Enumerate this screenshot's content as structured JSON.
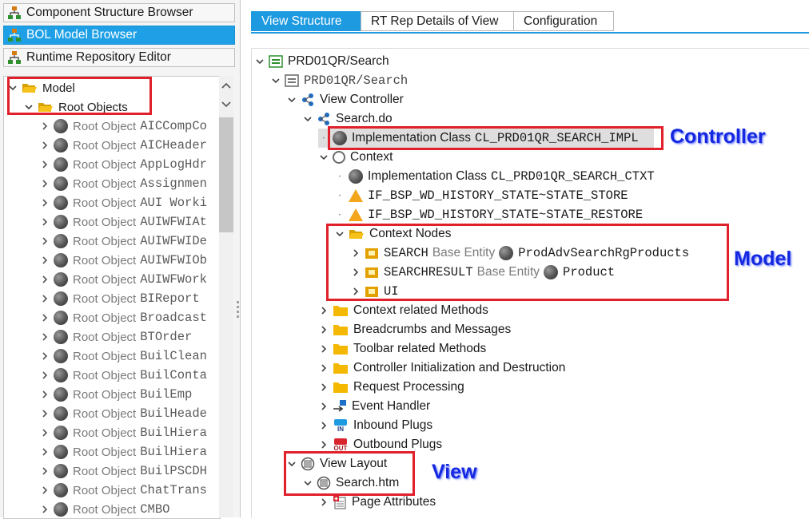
{
  "left_panel": {
    "nav": [
      {
        "label": "Component Structure Browser",
        "icon": "hierarchy-icon",
        "active": false
      },
      {
        "label": "BOL Model Browser",
        "icon": "hierarchy-icon",
        "active": true
      },
      {
        "label": "Runtime Repository Editor",
        "icon": "hierarchy-icon",
        "active": false
      }
    ],
    "tree": {
      "model_label": "Model",
      "root_objects_label": "Root Objects",
      "item_prefix": "Root Object",
      "items": [
        "AICCompCo",
        "AICHeader",
        "AppLogHdr",
        "Assignmen",
        "AUI Worki",
        "AUIWFWIAt",
        "AUIWFWIDe",
        "AUIWFWIOb",
        "AUIWFWork",
        "BIReport",
        "Broadcast",
        "BTOrder",
        "BuilClean",
        "BuilConta",
        "BuilEmp",
        "BuilHeade",
        "BuilHiera",
        "BuilHiera",
        "BuilPSCDH",
        "ChatTrans",
        "CMBO"
      ]
    }
  },
  "tabs": [
    "View Structure",
    "RT Rep Details of View",
    "Configuration"
  ],
  "tree": {
    "root": "PRD01QR/Search",
    "view": "PRD01QR/Search",
    "view_controller": "View Controller",
    "search_do": "Search.do",
    "impl_class_label": "Implementation Class",
    "impl_class_value": "CL_PRD01QR_SEARCH_IMPL",
    "context": "Context",
    "ctxt_class_label": "Implementation Class",
    "ctxt_class_value": "CL_PRD01QR_SEARCH_CTXT",
    "history_store": "IF_BSP_WD_HISTORY_STATE~STATE_STORE",
    "history_restore": "IF_BSP_WD_HISTORY_STATE~STATE_RESTORE",
    "context_nodes": "Context Nodes",
    "node1_name": "SEARCH",
    "node1_base": "Base Entity",
    "node1_entity": "ProdAdvSearchRgProducts",
    "node2_name": "SEARCHRESULT",
    "node2_base": "Base Entity",
    "node2_entity": "Product",
    "node3_name": "UI",
    "folders": [
      "Context related Methods",
      "Breadcrumbs and Messages",
      "Toolbar related Methods",
      "Controller Initialization and Destruction",
      "Request Processing"
    ],
    "event_handler": "Event Handler",
    "inbound_plugs": "Inbound Plugs",
    "in_badge": "IN",
    "outbound_plugs": "Outbound Plugs",
    "out_badge": "OUT",
    "view_layout": "View Layout",
    "search_htm": "Search.htm",
    "page_attributes": "Page Attributes"
  },
  "annotations": {
    "controller": "Controller",
    "model": "Model",
    "view": "View"
  },
  "colors": {
    "accent": "#1e9ae0",
    "annotation": "#1528e0",
    "highlight_box": "#e0202a",
    "folder": "#f5b800"
  }
}
